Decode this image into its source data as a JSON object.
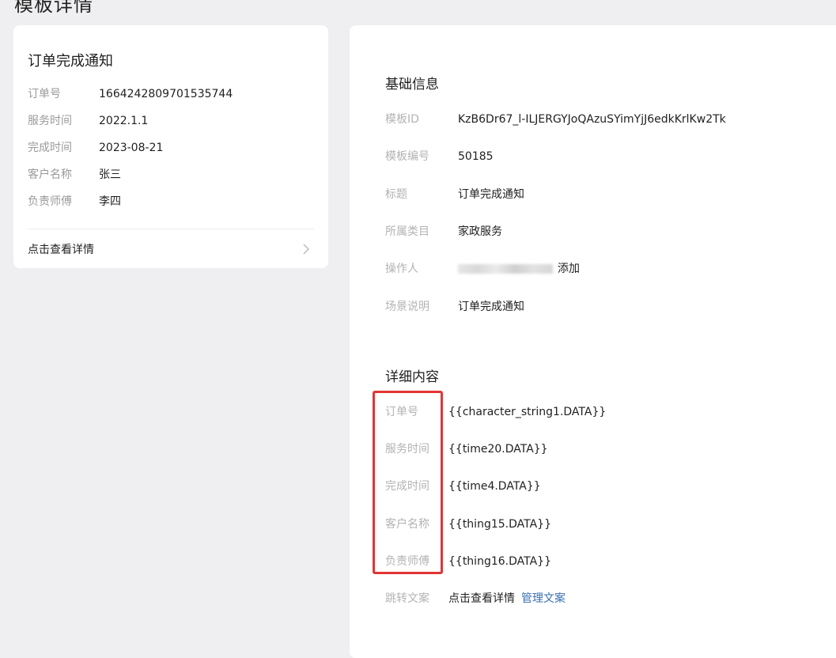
{
  "page": {
    "title": "模板详情"
  },
  "preview": {
    "title": "订单完成通知",
    "rows": [
      {
        "label": "订单号",
        "value": "1664242809701535744"
      },
      {
        "label": "服务时间",
        "value": "2022.1.1"
      },
      {
        "label": "完成时间",
        "value": "2023-08-21"
      },
      {
        "label": "客户名称",
        "value": "张三"
      },
      {
        "label": "负责师傅",
        "value": "李四"
      }
    ],
    "link_text": "点击查看详情"
  },
  "basic": {
    "title": "基础信息",
    "fields": [
      {
        "label": "模板ID",
        "value": "KzB6Dr67_l-ILJERGYJoQAzuSYimYjJ6edkKrlKw2Tk"
      },
      {
        "label": "模板编号",
        "value": "50185"
      },
      {
        "label": "标题",
        "value": "订单完成通知"
      },
      {
        "label": "所属类目",
        "value": "家政服务"
      },
      {
        "label": "操作人",
        "value": "添加"
      },
      {
        "label": "场景说明",
        "value": "订单完成通知"
      }
    ]
  },
  "detail": {
    "title": "详细内容",
    "fields": [
      {
        "label": "订单号",
        "value": "{{character_string1.DATA}}"
      },
      {
        "label": "服务时间",
        "value": "{{time20.DATA}}"
      },
      {
        "label": "完成时间",
        "value": "{{time4.DATA}}"
      },
      {
        "label": "客户名称",
        "value": "{{thing15.DATA}}"
      },
      {
        "label": "负责师傅",
        "value": "{{thing16.DATA}}"
      }
    ],
    "jump": {
      "label": "跳转文案",
      "value": "点击查看详情",
      "link": "管理文案"
    }
  },
  "colors": {
    "highlight": "#e33434",
    "link": "#3a6fb3"
  },
  "icons": {
    "preview_link": "chevron-right-icon"
  }
}
